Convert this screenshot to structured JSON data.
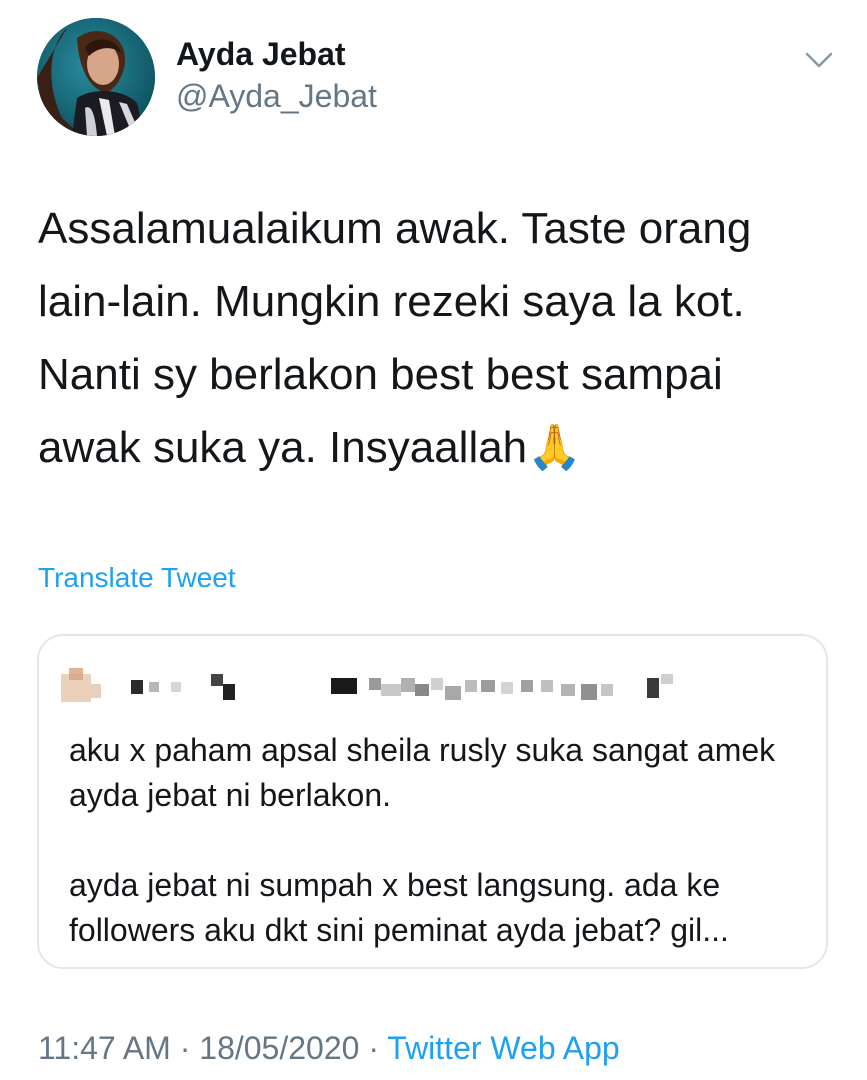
{
  "author": {
    "display_name": "Ayda Jebat",
    "handle": "@Ayda_Jebat"
  },
  "tweet": {
    "text": "Assalamualaikum awak. Taste orang\nlain-lain. Mungkin rezeki saya la kot.\nNanti sy berlakon best best sampai\nawak suka ya. Insyaallah🙏"
  },
  "translate_label": "Translate Tweet",
  "quoted_tweet": {
    "paragraphs": [
      "aku x paham apsal sheila rusly suka sangat amek ayda jebat ni berlakon.",
      "ayda jebat ni sumpah x best langsung. ada ke followers aku dkt sini peminat ayda jebat? gil..."
    ]
  },
  "meta": {
    "time": "11:47 AM",
    "separator_1": " · ",
    "date": "18/05/2020",
    "separator_2": " · ",
    "source": "Twitter Web App"
  },
  "icons": {
    "menu": "chevron-down-icon",
    "avatar": "avatar"
  },
  "colors": {
    "link": "#1da1f2",
    "secondary_text": "#657786",
    "primary_text": "#14171a",
    "border": "#e1e8ed"
  }
}
